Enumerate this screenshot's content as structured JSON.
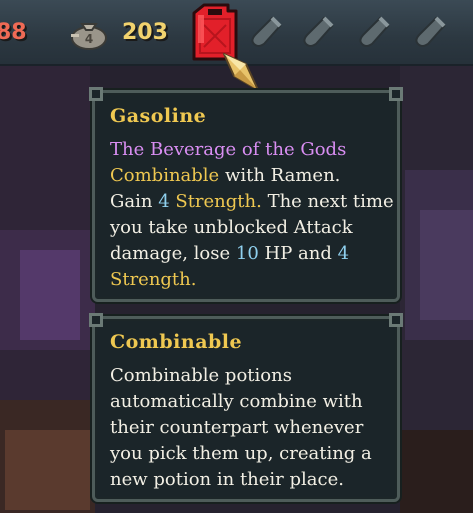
{
  "hud": {
    "hp_value": "88",
    "gold_value": "203",
    "money_bag_glyph": "4"
  },
  "icons": {
    "money": "money-bag-icon",
    "gasoline": "gasoline-can-icon",
    "empty_slot": "empty-potion-slot-icon",
    "cursor": "crystal-cursor-icon"
  },
  "potion_slots": [
    {
      "state": "empty"
    },
    {
      "state": "empty"
    },
    {
      "state": "empty"
    },
    {
      "state": "empty"
    }
  ],
  "tooltip_gasoline": {
    "title": "Gasoline",
    "flavor": "The Beverage of the Gods",
    "combine_word": "Combinable",
    "combine_rest": " with Ramen.",
    "l3_a": "Gain ",
    "l3_num": "4",
    "l3_b": " Strength.",
    "l3_c": " The next time",
    "l4": "you take unblocked Attack",
    "l5_a": "damage, lose ",
    "l5_num1": "10",
    "l5_b": " HP and ",
    "l5_num2": "4",
    "l6": "Strength."
  },
  "tooltip_combinable": {
    "title": "Combinable",
    "lines": [
      "Combinable potions",
      "automatically combine with",
      "their counterpart whenever",
      "you pick them up, creating a",
      "new potion in their place."
    ]
  },
  "colors": {
    "keyword_purple": "#d98ef2",
    "keyword_gold": "#efc851",
    "number_blue": "#8fd0ee",
    "hp_red": "#f06a55",
    "gold_yellow": "#f2d36e",
    "gas_red": "#e2202a"
  }
}
